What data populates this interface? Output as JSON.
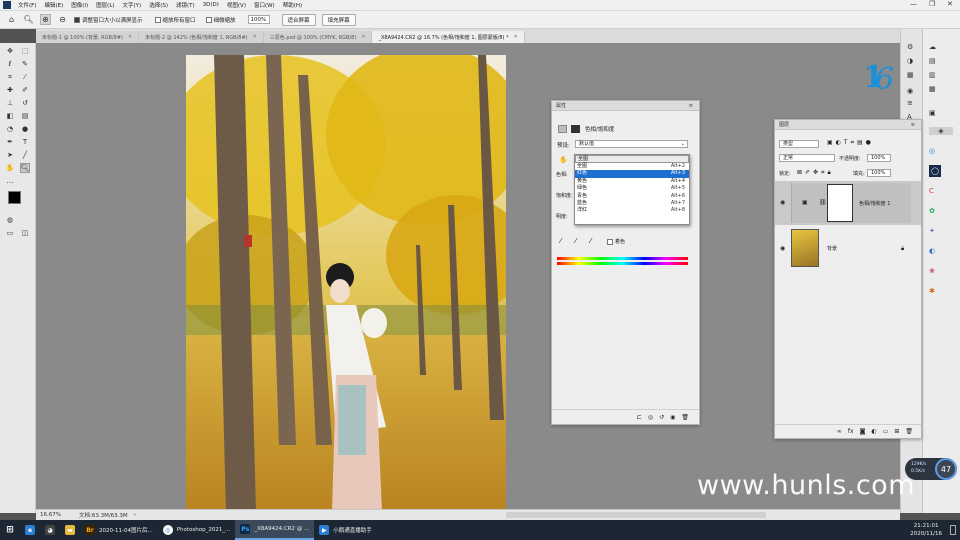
{
  "menubar": {
    "items": [
      "文件(F)",
      "编辑(E)",
      "图像(I)",
      "图层(L)",
      "文字(Y)",
      "选择(S)",
      "滤镜(T)",
      "3D(D)",
      "视图(V)",
      "窗口(W)",
      "帮助(H)"
    ]
  },
  "optionsbar": {
    "resize_windows": "调整窗口大小以满屏显示",
    "zoom_all": "缩放所有窗口",
    "scrubby_zoom": "细微缩放",
    "zoom_value": "100%",
    "fit_screen": "适合屏幕",
    "fill_screen": "填充屏幕"
  },
  "tabs": [
    {
      "label": "未标题-1 @ 100% (背景, RGB/8#)"
    },
    {
      "label": "未标题-2 @ 142% (色相/饱和度 1, RGB/8#)"
    },
    {
      "label": "三原色.psd @ 100% (CMYK, RGB/8)"
    },
    {
      "label": "_X8A9424.CR2 @ 16.7% (色相/饱和度 1, 图层蒙版/8) *"
    }
  ],
  "status": {
    "zoom": "16.67%",
    "doc": "文档:63.3M/63.3M"
  },
  "properties": {
    "tab_title": "属性",
    "header": "色相/饱和度",
    "preset_label": "预设:",
    "preset_value": "默认值",
    "hue_label": "色相:",
    "sat_label": "饱和度:",
    "light_label": "明度:",
    "colorize": "着色",
    "channel_options": [
      {
        "label": "全图",
        "shortcut": "Alt+2"
      },
      {
        "label": "红色",
        "shortcut": "Alt+3"
      },
      {
        "label": "黄色",
        "shortcut": "Alt+4"
      },
      {
        "label": "绿色",
        "shortcut": "Alt+5"
      },
      {
        "label": "青色",
        "shortcut": "Alt+6"
      },
      {
        "label": "蓝色",
        "shortcut": "Alt+7"
      },
      {
        "label": "洋红",
        "shortcut": "Alt+8"
      }
    ],
    "channel_top": "全图"
  },
  "layers": {
    "tab_title": "图层",
    "filter_kind": "类型",
    "blend_mode": "正常",
    "opacity_label": "不透明度:",
    "opacity_value": "100%",
    "lock_label": "锁定:",
    "fill_label": "填充:",
    "fill_value": "100%",
    "items": [
      {
        "name": "色相/饱和度 1"
      },
      {
        "name": "背景"
      }
    ]
  },
  "taskbar": {
    "items": [
      {
        "label": "2020-11-04图片后..."
      },
      {
        "label": "Photoshop_2021_..."
      },
      {
        "label": "_X8A9424.CR2 @ ..."
      },
      {
        "label": "小鹅通直播助手"
      }
    ],
    "time": "21:21:01",
    "date": "2020/11/16"
  },
  "watermark": "www.hunls.com",
  "speed_widget": {
    "up": "129K/s",
    "down": "0.5K/s",
    "percent": "47"
  }
}
